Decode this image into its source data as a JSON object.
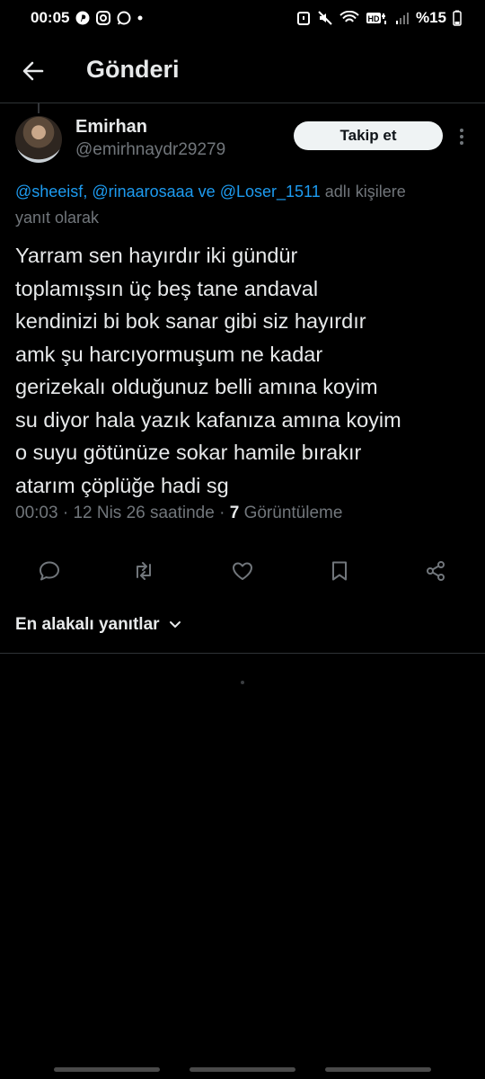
{
  "status_bar": {
    "time": "00:05",
    "battery": "%15"
  },
  "header": {
    "title": "Gönderi"
  },
  "tweet": {
    "display_name": "Emirhan",
    "handle": "@emirhnaydr29279",
    "follow_label": "Takip et",
    "reply_context": {
      "mention1": "@sheeisf",
      "sep1": ", ",
      "mention2": "@rinaarosaaa",
      "and": " ve ",
      "mention3": "@Loser_1511",
      "suffix": " adlı kişilere",
      "line2": "yanıt olarak"
    },
    "text_lines": [
      "Yarram sen hayırdır iki gündür",
      "toplamışsın üç beş tane andaval",
      "kendinizi bi bok sanar gibi siz hayırdır",
      "amk şu harcıyormuşum ne kadar",
      "gerizekalı olduğunuz belli amına koyim",
      "su diyor hala yazık kafanıza amına koyim",
      "o suyu götünüze sokar hamile bırakır",
      "atarım çöplüğe hadi sg"
    ],
    "time": "00:03",
    "date": "12 Nis 26 saatinde",
    "views_count": "7",
    "views_label": "Görüntüleme",
    "sep": " · "
  },
  "actions": [
    "reply-icon",
    "retweet-icon",
    "like-icon",
    "bookmark-icon",
    "share-icon"
  ],
  "sort": {
    "label": "En alakalı yanıtlar"
  }
}
